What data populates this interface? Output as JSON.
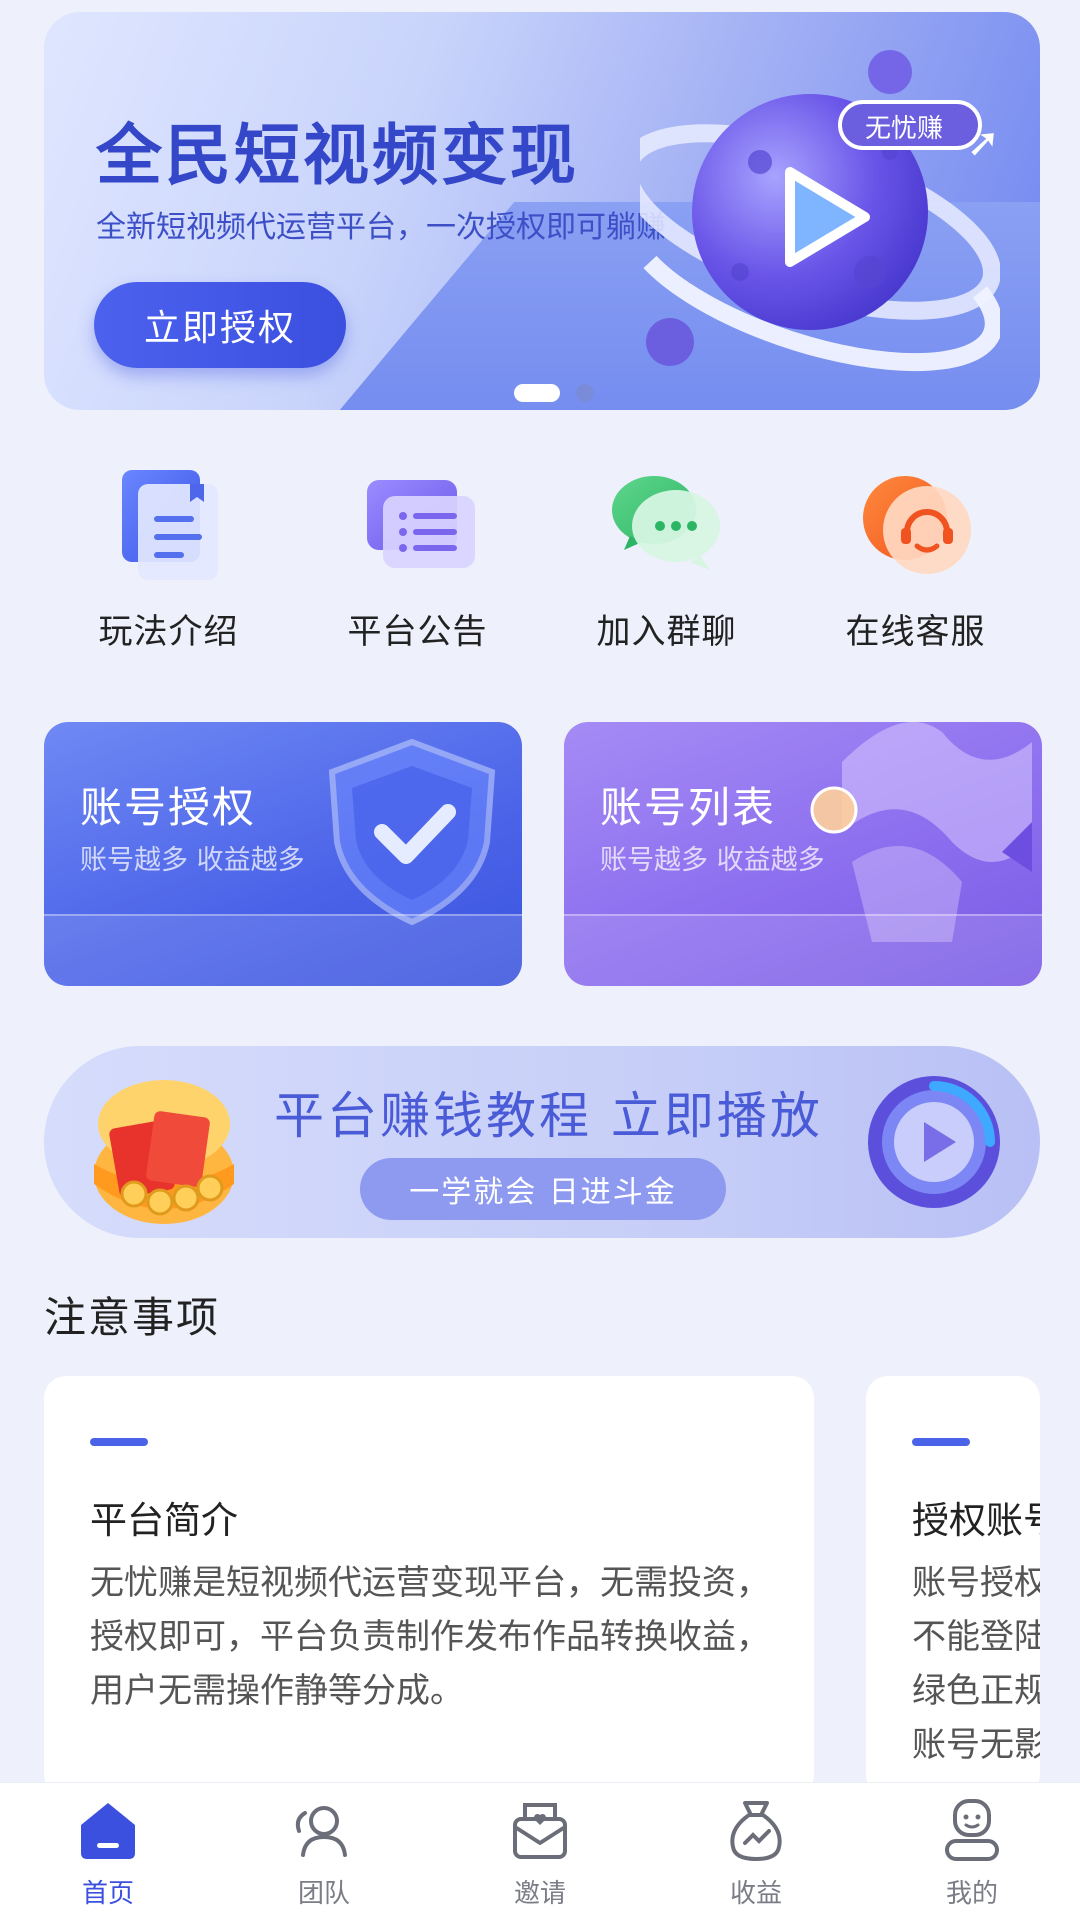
{
  "hero": {
    "title": "全民短视频变现",
    "subtitle": "全新短视频代运营平台，一次授权即可躺赚",
    "button": "立即授权",
    "tag": "无忧赚",
    "carousel_total": 2,
    "carousel_active": 1
  },
  "menu": [
    {
      "label": "玩法介绍",
      "icon": "document-icon"
    },
    {
      "label": "平台公告",
      "icon": "announcement-list-icon"
    },
    {
      "label": "加入群聊",
      "icon": "chat-bubbles-icon"
    },
    {
      "label": "在线客服",
      "icon": "headset-icon"
    }
  ],
  "cards": {
    "auth": {
      "title": "账号授权",
      "subtitle": "账号越多 收益越多"
    },
    "list": {
      "title": "账号列表",
      "subtitle": "账号越多 收益越多"
    }
  },
  "tutorial": {
    "title": "平台赚钱教程 立即播放",
    "pill": "一学就会 日进斗金"
  },
  "notices": {
    "section_title": "注意事项",
    "items": [
      {
        "title": "平台简介",
        "body": "无忧赚是短视频代运营变现平台，无需投资，授权即可，平台负责制作发布作品转换收益，用户无需操作静等分成。"
      },
      {
        "title": "授权账号",
        "lines": [
          "账号授权",
          "不能登陆",
          "绿色正规",
          "账号无影"
        ]
      }
    ]
  },
  "tabbar": [
    {
      "label": "首页",
      "icon": "home-icon",
      "active": true
    },
    {
      "label": "团队",
      "icon": "team-icon",
      "active": false
    },
    {
      "label": "邀请",
      "icon": "invite-envelope-icon",
      "active": false
    },
    {
      "label": "收益",
      "icon": "money-bag-icon",
      "active": false
    },
    {
      "label": "我的",
      "icon": "profile-icon",
      "active": false
    }
  ],
  "colors": {
    "primary": "#3c50e0",
    "background": "#eef0fb",
    "purple": "#8a6cee"
  }
}
